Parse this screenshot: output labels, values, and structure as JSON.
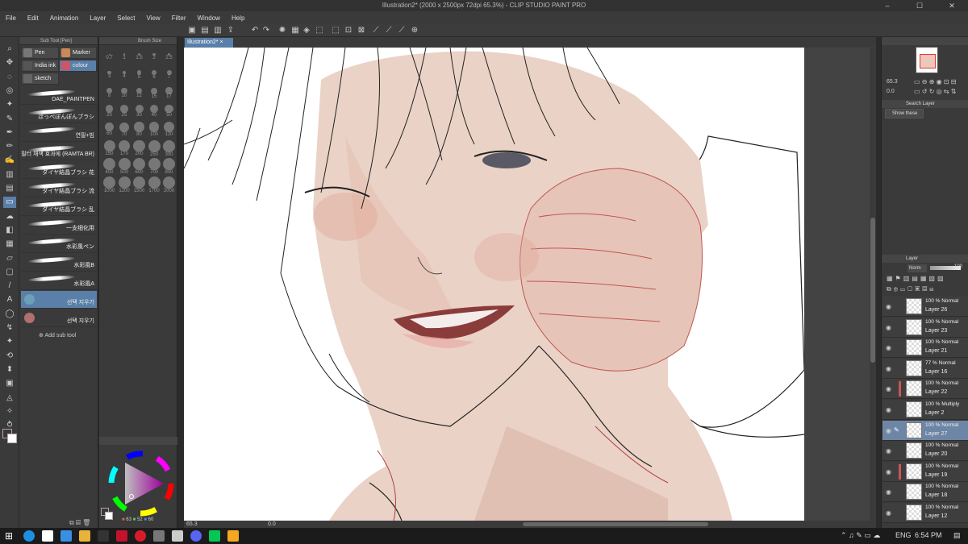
{
  "window": {
    "title": "Illustration2* (2000 x 2500px 72dpi 65.3%) - CLIP STUDIO PAINT PRO"
  },
  "menu": [
    "File",
    "Edit",
    "Animation",
    "Layer",
    "Select",
    "View",
    "Filter",
    "Window",
    "Help"
  ],
  "document_tab": "Illustration2*",
  "sub_tool": {
    "header": "Sub Tool [Pen]",
    "groups": [
      {
        "label": "Pen",
        "color": "#777777"
      },
      {
        "label": "Marker",
        "color": "#c98a5a"
      },
      {
        "label": "India ink",
        "color": "#555555"
      },
      {
        "label": "colour",
        "color": "#cc5566"
      },
      {
        "label": "sketch",
        "color": "#666666"
      }
    ],
    "brushes": [
      "DAE_PAINTPEN",
      "ほっぺぽんぽんブラシ",
      "연필+빔",
      "필터 채색 효과에 (RAMTA BR)",
      "ダイヤ結晶ブラシ 花",
      "ダイヤ結晶ブラシ 流",
      "ダイヤ結晶ブラシ 乱",
      "一支细化用",
      "水彩風ペン",
      "水彩風B",
      "水彩風A",
      "선택 지우기",
      "선택 지우기"
    ],
    "add_label": "Add sub tool"
  },
  "brush_size": {
    "header": "Brush Size",
    "sizes": [
      "0.7",
      "1",
      "1.5",
      "2",
      "2.5",
      "3",
      "4",
      "5",
      "6",
      "7",
      "8",
      "10",
      "12",
      "15",
      "17",
      "20",
      "25",
      "30",
      "40",
      "50",
      "60",
      "70",
      "80",
      "100",
      "120",
      "150",
      "170",
      "200",
      "250",
      "300",
      "400",
      "500",
      "600",
      "700",
      "800",
      "1000",
      "1200",
      "1500",
      "1700",
      "2000"
    ]
  },
  "color": {
    "r": "63",
    "g": "52",
    "b": "60",
    "main": "#3f343c"
  },
  "navigator": {
    "zoom": "65.3",
    "angle": "0.0"
  },
  "search_layer": {
    "header": "Search Layer",
    "filter": "Show these"
  },
  "layer_panel": {
    "header": "Layer",
    "blend": "Norm",
    "opacity": "100",
    "layers": [
      {
        "mode": "100 % Normal",
        "name": "Layer 26",
        "sel": false,
        "red": false
      },
      {
        "mode": "100 % Normal",
        "name": "Layer 23",
        "sel": false,
        "red": false
      },
      {
        "mode": "100 % Normal",
        "name": "Layer 21",
        "sel": false,
        "red": false
      },
      {
        "mode": "77 % Normal",
        "name": "Layer 16",
        "sel": false,
        "red": false
      },
      {
        "mode": "100 % Normal",
        "name": "Layer 22",
        "sel": false,
        "red": true
      },
      {
        "mode": "100 % Multiply",
        "name": "Layer 2",
        "sel": false,
        "red": false
      },
      {
        "mode": "100 % Normal",
        "name": "Layer 27",
        "sel": true,
        "red": false
      },
      {
        "mode": "100 % Normal",
        "name": "Layer 20",
        "sel": false,
        "red": false
      },
      {
        "mode": "100 % Normal",
        "name": "Layer 19",
        "sel": false,
        "red": true
      },
      {
        "mode": "100 % Normal",
        "name": "Layer 18",
        "sel": false,
        "red": false
      },
      {
        "mode": "100 % Normal",
        "name": "Layer 12",
        "sel": false,
        "red": false
      }
    ]
  },
  "status": {
    "zoom": "65.3",
    "angle": "0.0"
  },
  "taskbar": {
    "lang": "ENG",
    "time": "6:54 PM"
  }
}
